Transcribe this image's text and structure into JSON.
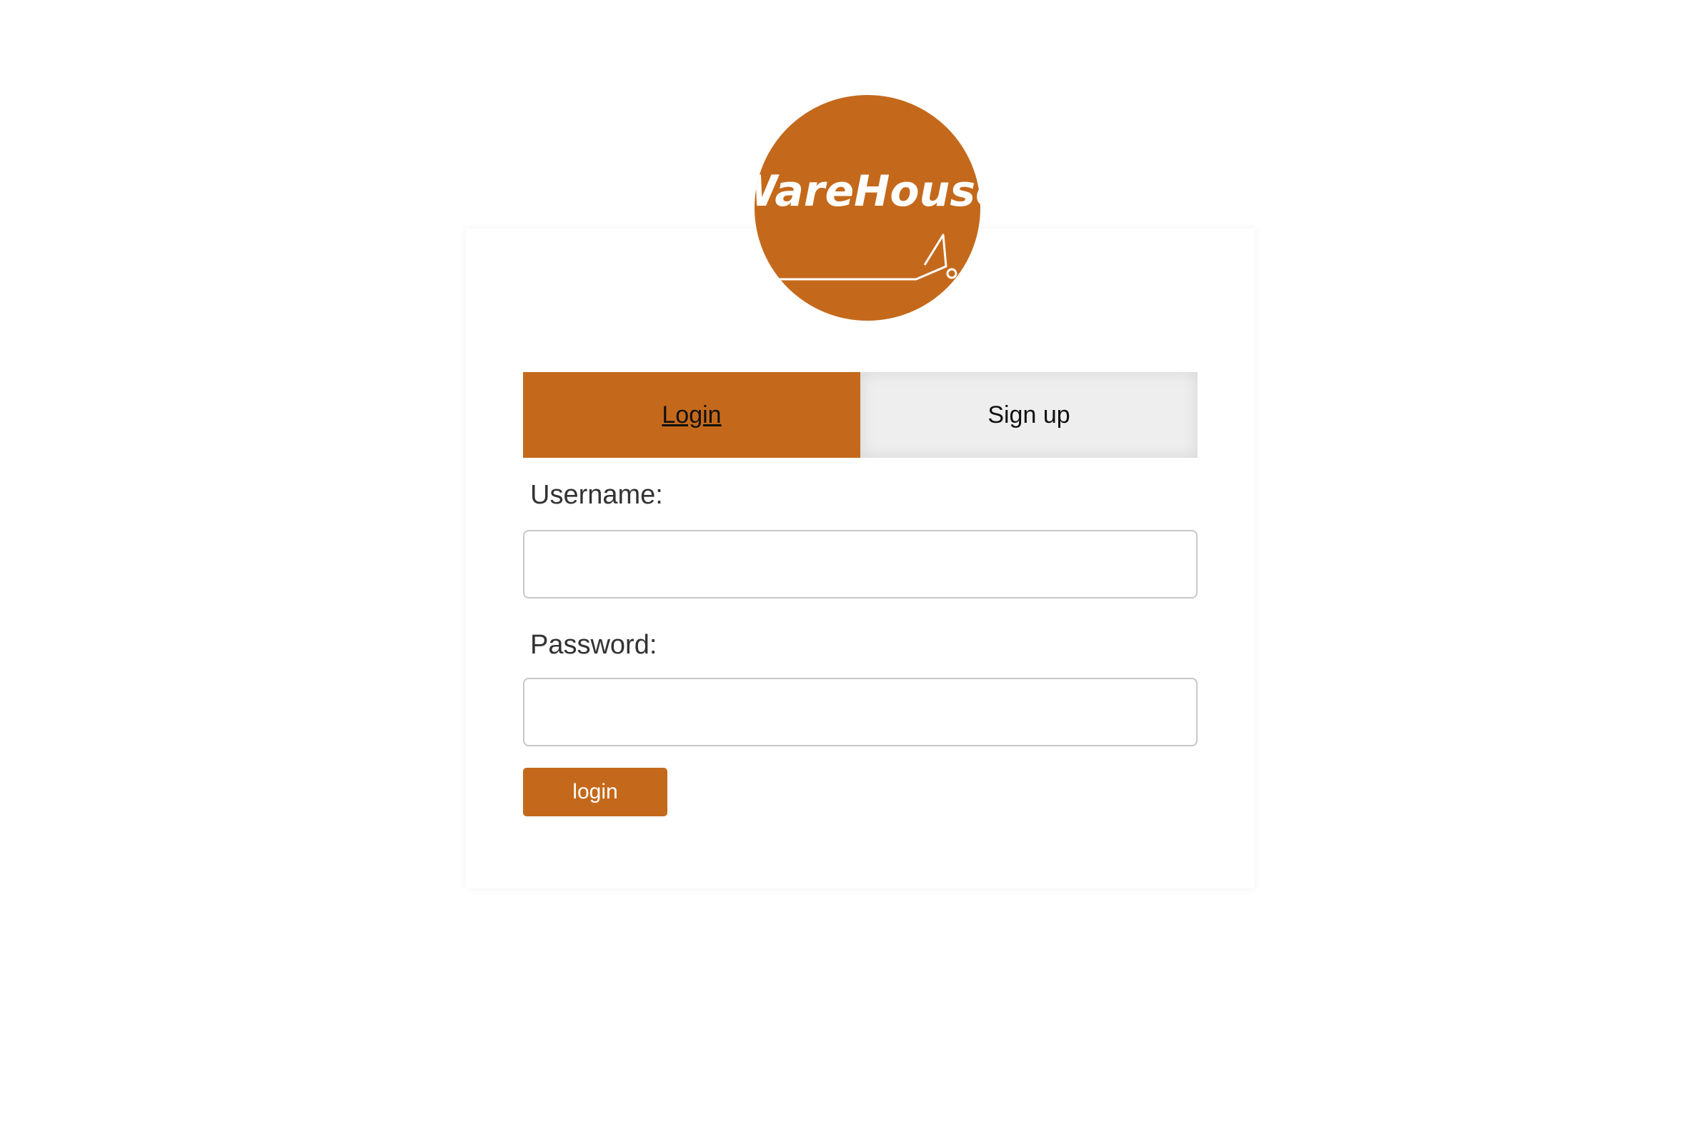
{
  "logo": {
    "text": "WareHouse",
    "background_color": "#c4691b",
    "icon": "warehouse-logo-icon"
  },
  "tabs": [
    {
      "label": "Login",
      "active": true
    },
    {
      "label": "Sign up",
      "active": false
    }
  ],
  "form": {
    "username_label": "Username:",
    "username_value": "",
    "password_label": "Password:",
    "password_value": "",
    "submit_label": "login"
  },
  "colors": {
    "accent": "#c4691b",
    "tab_inactive": "#eeeeee",
    "input_border": "#c8c8c8"
  }
}
